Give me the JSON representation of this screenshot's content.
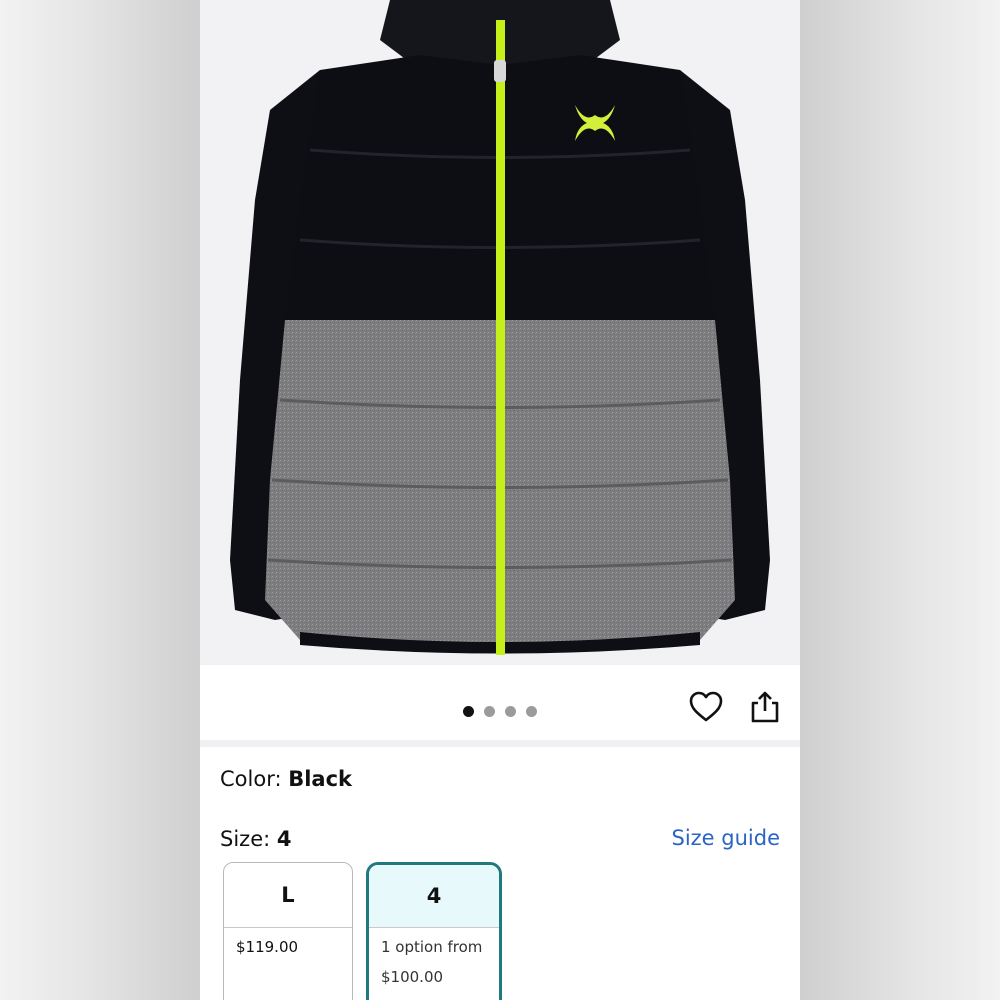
{
  "gallery": {
    "image_alt": "Under Armour black and gray hooded puffer jacket",
    "dots": [
      {
        "active": true
      },
      {
        "active": false
      },
      {
        "active": false
      },
      {
        "active": false
      }
    ],
    "favorite_icon": "heart-outline-icon",
    "share_icon": "share-icon"
  },
  "color": {
    "label": "Color: ",
    "value": "Black"
  },
  "size": {
    "label": "Size: ",
    "value": "4",
    "guide_label": "Size guide"
  },
  "size_options": [
    {
      "size": "L",
      "price": "$119.00"
    },
    {
      "size": "4",
      "options_text": "1 option from",
      "price": "$100.00"
    }
  ],
  "colors": {
    "link": "#2a64c5",
    "selected_border": "#1f7a80",
    "selected_fill": "#e8f9fc",
    "zipper": "#c6f019"
  }
}
